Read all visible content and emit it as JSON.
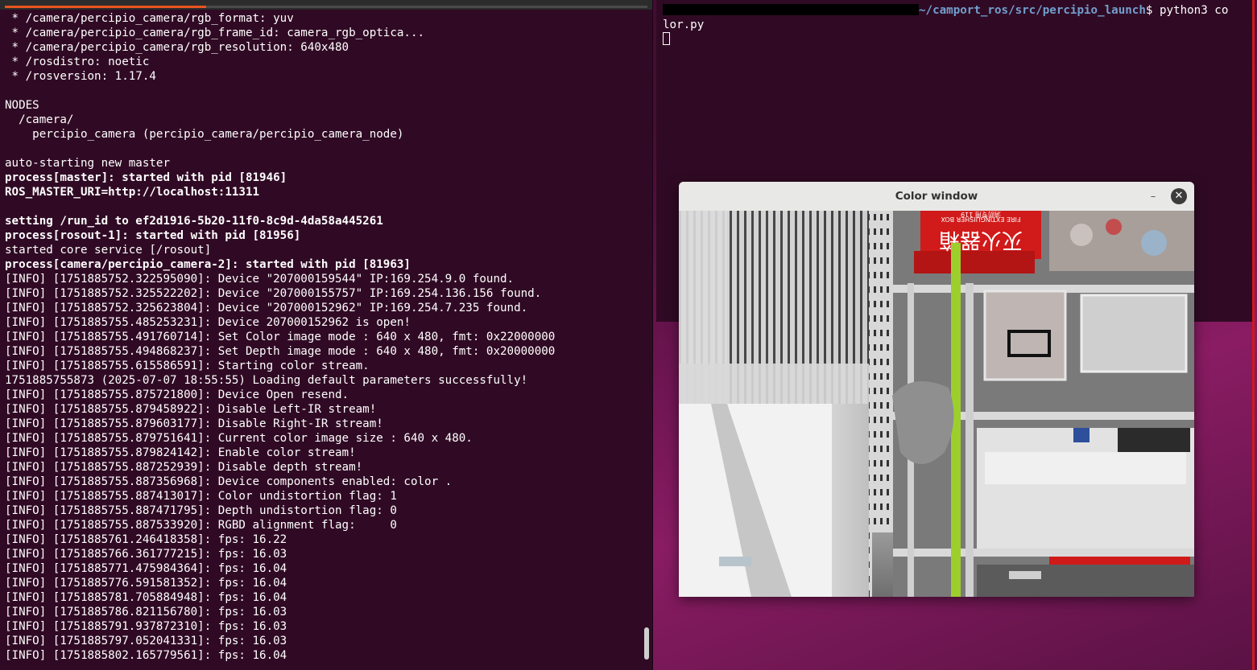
{
  "left_terminal": {
    "lines": [
      {
        "text": " * /camera/percipio_camera/rgb_format: yuv",
        "bold": false
      },
      {
        "text": " * /camera/percipio_camera/rgb_frame_id: camera_rgb_optica...",
        "bold": false
      },
      {
        "text": " * /camera/percipio_camera/rgb_resolution: 640x480",
        "bold": false
      },
      {
        "text": " * /rosdistro: noetic",
        "bold": false
      },
      {
        "text": " * /rosversion: 1.17.4",
        "bold": false
      },
      {
        "text": "",
        "bold": false
      },
      {
        "text": "NODES",
        "bold": false
      },
      {
        "text": "  /camera/",
        "bold": false
      },
      {
        "text": "    percipio_camera (percipio_camera/percipio_camera_node)",
        "bold": false
      },
      {
        "text": "",
        "bold": false
      },
      {
        "text": "auto-starting new master",
        "bold": false
      },
      {
        "text": "process[master]: started with pid [81946]",
        "bold": true
      },
      {
        "text": "ROS_MASTER_URI=http://localhost:11311",
        "bold": true
      },
      {
        "text": "",
        "bold": false
      },
      {
        "text": "setting /run_id to ef2d1916-5b20-11f0-8c9d-4da58a445261",
        "bold": true
      },
      {
        "text": "process[rosout-1]: started with pid [81956]",
        "bold": true
      },
      {
        "text": "started core service [/rosout]",
        "bold": false
      },
      {
        "text": "process[camera/percipio_camera-2]: started with pid [81963]",
        "bold": true
      },
      {
        "text": "[INFO] [1751885752.322595090]: Device \"207000159544\" IP:169.254.9.0 found.",
        "bold": false
      },
      {
        "text": "[INFO] [1751885752.325522202]: Device \"207000155757\" IP:169.254.136.156 found.",
        "bold": false
      },
      {
        "text": "[INFO] [1751885752.325623804]: Device \"207000152962\" IP:169.254.7.235 found.",
        "bold": false
      },
      {
        "text": "[INFO] [1751885755.485253231]: Device 207000152962 is open!",
        "bold": false
      },
      {
        "text": "[INFO] [1751885755.491760714]: Set Color image mode : 640 x 480, fmt: 0x22000000",
        "bold": false
      },
      {
        "text": "[INFO] [1751885755.494868237]: Set Depth image mode : 640 x 480, fmt: 0x20000000",
        "bold": false
      },
      {
        "text": "[INFO] [1751885755.615586591]: Starting color stream.",
        "bold": false
      },
      {
        "text": "1751885755873 (2025-07-07 18:55:55) Loading default parameters successfully!",
        "bold": false
      },
      {
        "text": "[INFO] [1751885755.875721800]: Device Open resend.",
        "bold": false
      },
      {
        "text": "[INFO] [1751885755.879458922]: Disable Left-IR stream!",
        "bold": false
      },
      {
        "text": "[INFO] [1751885755.879603177]: Disable Right-IR stream!",
        "bold": false
      },
      {
        "text": "[INFO] [1751885755.879751641]: Current color image size : 640 x 480.",
        "bold": false
      },
      {
        "text": "[INFO] [1751885755.879824142]: Enable color stream!",
        "bold": false
      },
      {
        "text": "[INFO] [1751885755.887252939]: Disable depth stream!",
        "bold": false
      },
      {
        "text": "[INFO] [1751885755.887356968]: Device components enabled: color .",
        "bold": false
      },
      {
        "text": "[INFO] [1751885755.887413017]: Color undistortion flag: 1",
        "bold": false
      },
      {
        "text": "[INFO] [1751885755.887471795]: Depth undistortion flag: 0",
        "bold": false
      },
      {
        "text": "[INFO] [1751885755.887533920]: RGBD alignment flag:     0",
        "bold": false
      },
      {
        "text": "[INFO] [1751885761.246418358]: fps: 16.22",
        "bold": false
      },
      {
        "text": "[INFO] [1751885766.361777215]: fps: 16.03",
        "bold": false
      },
      {
        "text": "[INFO] [1751885771.475984364]: fps: 16.04",
        "bold": false
      },
      {
        "text": "[INFO] [1751885776.591581352]: fps: 16.04",
        "bold": false
      },
      {
        "text": "[INFO] [1751885781.705884948]: fps: 16.04",
        "bold": false
      },
      {
        "text": "[INFO] [1751885786.821156780]: fps: 16.03",
        "bold": false
      },
      {
        "text": "[INFO] [1751885791.937872310]: fps: 16.03",
        "bold": false
      },
      {
        "text": "[INFO] [1751885797.052041331]: fps: 16.03",
        "bold": false
      },
      {
        "text": "[INFO] [1751885802.165779561]: fps: 16.04",
        "bold": false
      }
    ]
  },
  "right_terminal": {
    "prompt_path": "~/camport_ros/src/percipio_launch",
    "prompt_symbol": "$ ",
    "command_part1": "python3 co",
    "command_part2": "lor.py"
  },
  "color_window": {
    "title": "Color window",
    "minimize_symbol": "–",
    "close_symbol": "✕",
    "box_label_cn": "灭火器箱",
    "box_label_en": "FIRE EXTINGUISHER BOX",
    "box_label_small": "消防专用 119"
  },
  "colors": {
    "terminal_bg": "#300a24",
    "terminal_fg": "#ffffff",
    "prompt_path": "#729fcf",
    "accent": "#e95420"
  }
}
